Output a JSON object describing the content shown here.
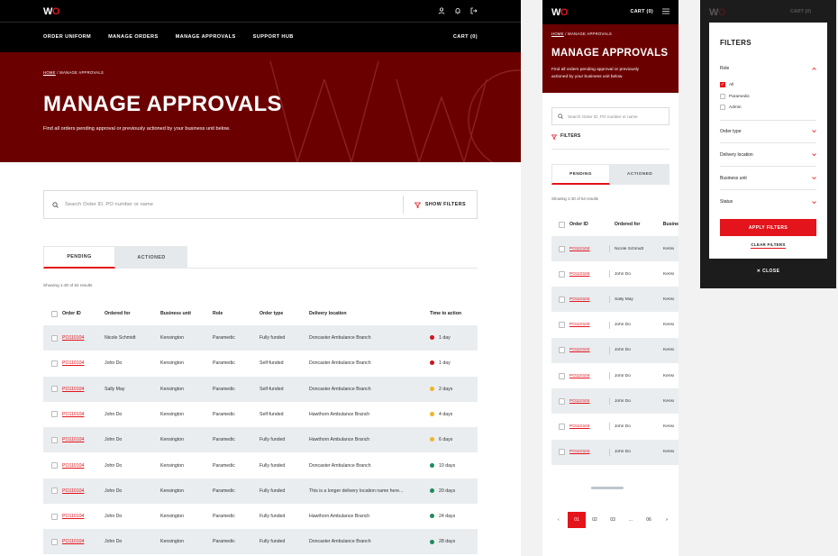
{
  "brand": {
    "logo_text": "W",
    "logo_accent": "O",
    "accent_color": "#e3141b",
    "hero_color": "#6b0000"
  },
  "desktop": {
    "nav": [
      "ORDER UNIFORM",
      "MANAGE ORDERS",
      "MANAGE APPROVALS",
      "SUPPORT HUB"
    ],
    "cart": "CART (0)",
    "util_icons": [
      "user-icon",
      "bell-icon",
      "logout-icon"
    ],
    "breadcrumb": {
      "home": "HOME",
      "sep": "/",
      "current": "MANAGE APPROVALS"
    },
    "title": "MANAGE APPROVALS",
    "subtitle": "Find all orders pending approval or previously actioned by your business unit below.",
    "search_placeholder": "Search Order ID, PO number or name",
    "show_filters": "SHOW FILTERS",
    "tabs": [
      "PENDING",
      "ACTIONED"
    ],
    "showing": "Showing 1-30 of 54 results",
    "columns": [
      "Order ID",
      "Ordered for",
      "Business unit",
      "Role",
      "Order type",
      "Delivery location",
      "Time to action"
    ],
    "rows": [
      {
        "id": "PO110104",
        "for": "Nicole Schmidt",
        "unit": "Kensington",
        "role": "Paramedic",
        "type": "Fully funded",
        "loc": "Doncaster Ambulance Branch",
        "time": "1 day",
        "status": "red"
      },
      {
        "id": "PO110104",
        "for": "John Do",
        "unit": "Kensington",
        "role": "Paramedic",
        "type": "Self-funded",
        "loc": "Doncaster Ambulance Branch",
        "time": "1 day",
        "status": "red"
      },
      {
        "id": "PO110104",
        "for": "Sally May",
        "unit": "Kensington",
        "role": "Paramedic",
        "type": "Self-funded",
        "loc": "Doncaster Ambulance Branch",
        "time": "2 days",
        "status": "amber"
      },
      {
        "id": "PO110104",
        "for": "John Do",
        "unit": "Kensington",
        "role": "Paramedic",
        "type": "Self-funded",
        "loc": "Hawthorn Ambulance Branch",
        "time": "4 days",
        "status": "amber"
      },
      {
        "id": "PO110104",
        "for": "John Do",
        "unit": "Kensington",
        "role": "Paramedic",
        "type": "Fully funded",
        "loc": "Hawthorn Ambulance Branch",
        "time": "6 days",
        "status": "amber"
      },
      {
        "id": "PO110104",
        "for": "John Do",
        "unit": "Kensington",
        "role": "Paramedic",
        "type": "Fully funded",
        "loc": "Doncaster Ambulance Branch",
        "time": "10 days",
        "status": "green"
      },
      {
        "id": "PO110104",
        "for": "John Do",
        "unit": "Kensington",
        "role": "Paramedic",
        "type": "Fully funded",
        "loc": "This is a longer delivery location name here...",
        "time": "20 days",
        "status": "green"
      },
      {
        "id": "PO110104",
        "for": "John Do",
        "unit": "Kensington",
        "role": "Paramedic",
        "type": "Fully funded",
        "loc": "Hawthorn Ambulance Branch",
        "time": "24 days",
        "status": "green"
      },
      {
        "id": "PO110104",
        "for": "John Do",
        "unit": "Kensington",
        "role": "Paramedic",
        "type": "Fully funded",
        "loc": "Doncaster Ambulance Branch",
        "time": "28 days",
        "status": "green"
      }
    ],
    "status_colors": {
      "red": "#d0121a",
      "amber": "#f0b429",
      "green": "#1f8a5a"
    }
  },
  "mobile": {
    "cart": "CART (0)",
    "breadcrumb": {
      "home": "HOME",
      "sep": "/",
      "current": "MANAGE APPROVALS"
    },
    "title": "MANAGE APPROVALS",
    "subtitle_l1": "Find all orders pending approval or previously",
    "subtitle_l2": "actioned by your business unit below.",
    "search_placeholder": "Search Order ID, PO number or name",
    "filters": "FILTERS",
    "tabs": [
      "PENDING",
      "ACTIONED"
    ],
    "showing": "Showing 1-30 of 54 results",
    "columns": [
      "Order ID",
      "Ordered for",
      "Busine"
    ],
    "rows": [
      {
        "id": "PO110104",
        "for": "Nicole Schmidt",
        "unit": "Kensi"
      },
      {
        "id": "PO110104",
        "for": "John Do",
        "unit": "Kensi"
      },
      {
        "id": "PO110104",
        "for": "Sally May",
        "unit": "Kensi"
      },
      {
        "id": "PO110104",
        "for": "John Do",
        "unit": "Kensi"
      },
      {
        "id": "PO110104",
        "for": "John Do",
        "unit": "Kensi"
      },
      {
        "id": "PO110104",
        "for": "John Do",
        "unit": "Kensi"
      },
      {
        "id": "PO110104",
        "for": "John Do",
        "unit": "Kensi"
      },
      {
        "id": "PO110104",
        "for": "John Do",
        "unit": "Kensi"
      },
      {
        "id": "PO110104",
        "for": "John Do",
        "unit": "Kensi"
      }
    ],
    "pagination": [
      "01",
      "02",
      "03",
      "...",
      "06"
    ]
  },
  "filter_panel": {
    "title": "FILTERS",
    "role_label": "Role",
    "role_options": [
      {
        "label": "All",
        "checked": true
      },
      {
        "label": "Paramedic",
        "checked": false
      },
      {
        "label": "Admin",
        "checked": false
      }
    ],
    "sections": [
      "Order type",
      "Delivery location",
      "Business unit",
      "Status"
    ],
    "apply": "APPLY FILTERS",
    "clear": "CLEAR FILTERS",
    "close": "CLOSE",
    "close_x": "✕",
    "bg_cart": "CART (0)"
  }
}
